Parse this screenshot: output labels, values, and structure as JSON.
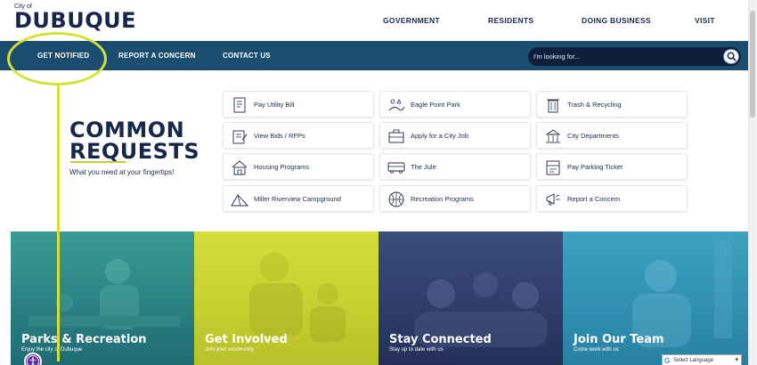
{
  "logo": {
    "small": "City of",
    "big": "DUBUQUE"
  },
  "topnav": [
    {
      "label": "GOVERNMENT"
    },
    {
      "label": "RESIDENTS"
    },
    {
      "label": "DOING BUSINESS"
    },
    {
      "label": "VISIT"
    }
  ],
  "subnav": [
    {
      "label": "GET NOTIFIED"
    },
    {
      "label": "REPORT A CONCERN"
    },
    {
      "label": "CONTACT US"
    }
  ],
  "search": {
    "placeholder": "I'm looking for..."
  },
  "common_requests": {
    "title_line1": "COMMON",
    "title_line2": "REQUESTS",
    "subtitle": "What you need at your fingertips!",
    "items": [
      {
        "label": "Pay Utility Bill",
        "icon": "bill-icon"
      },
      {
        "label": "Eagle Point Park",
        "icon": "park-icon"
      },
      {
        "label": "Trash & Recycling",
        "icon": "trash-icon"
      },
      {
        "label": "View Bids / RFPs",
        "icon": "document-icon"
      },
      {
        "label": "Apply for a City Job",
        "icon": "briefcase-icon"
      },
      {
        "label": "City Departments",
        "icon": "city-hall-icon"
      },
      {
        "label": "Housing Programs",
        "icon": "house-icon"
      },
      {
        "label": "The Jule",
        "icon": "bus-icon"
      },
      {
        "label": "Pay Parking Ticket",
        "icon": "parking-ticket-icon"
      },
      {
        "label": "Miller Riverview Campground",
        "icon": "tent-icon"
      },
      {
        "label": "Recreation Programs",
        "icon": "basketball-icon"
      },
      {
        "label": "Report a Concern",
        "icon": "megaphone-icon"
      }
    ]
  },
  "panels": [
    {
      "title": "Parks & Recreation",
      "subtitle": "Enjoy the city of Dubuque",
      "color": "#2f8d8a"
    },
    {
      "title": "Get Involved",
      "subtitle": "Join your community",
      "color": "#c7d133"
    },
    {
      "title": "Stay Connected",
      "subtitle": "Stay up to date with us",
      "color": "#2d3a66"
    },
    {
      "title": "Join Our Team",
      "subtitle": "Come work with us",
      "color": "#2f8fb0"
    }
  ],
  "language": {
    "label": "Select Language"
  }
}
